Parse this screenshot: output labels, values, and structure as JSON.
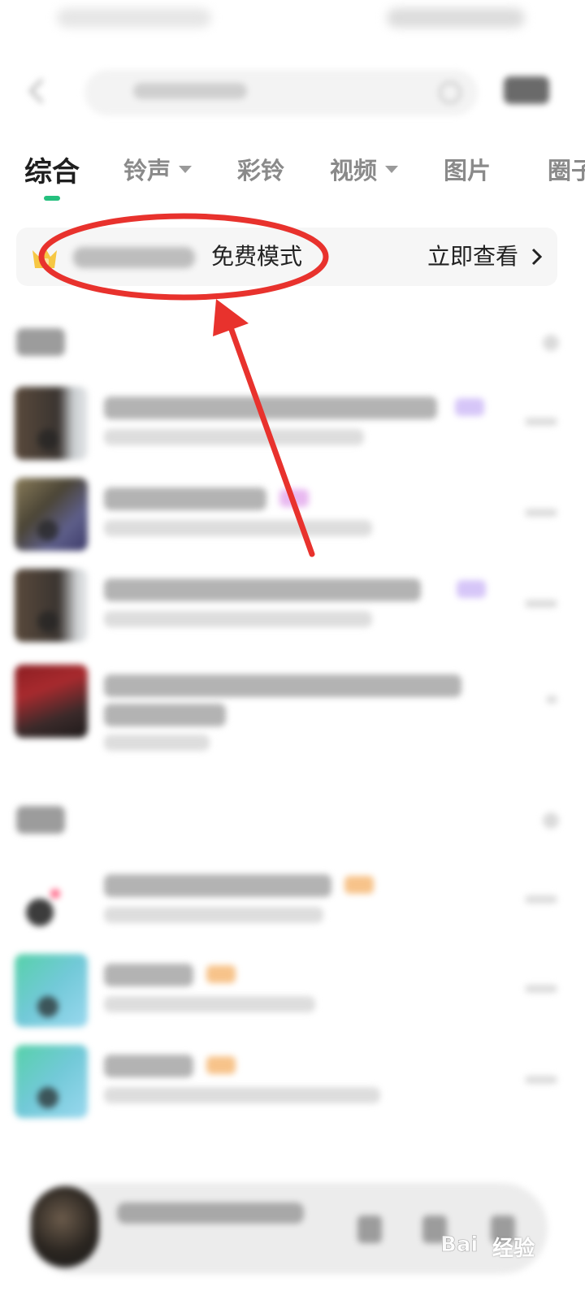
{
  "tabs": [
    {
      "label": "综合",
      "active": true
    },
    {
      "label": "铃声",
      "dropdown": true
    },
    {
      "label": "彩铃"
    },
    {
      "label": "视频",
      "dropdown": true
    },
    {
      "label": "图片"
    },
    {
      "label": "圈子"
    }
  ],
  "banner": {
    "text": "免费模式",
    "link": "立即查看",
    "icon": "crown-icon"
  },
  "annotation": {
    "color": "#e8322d"
  },
  "watermark": {
    "text": "经验"
  },
  "colors": {
    "accent": "#25c07e",
    "badge_purple": "#c7b3f5",
    "badge_orange": "#f5c38f"
  }
}
